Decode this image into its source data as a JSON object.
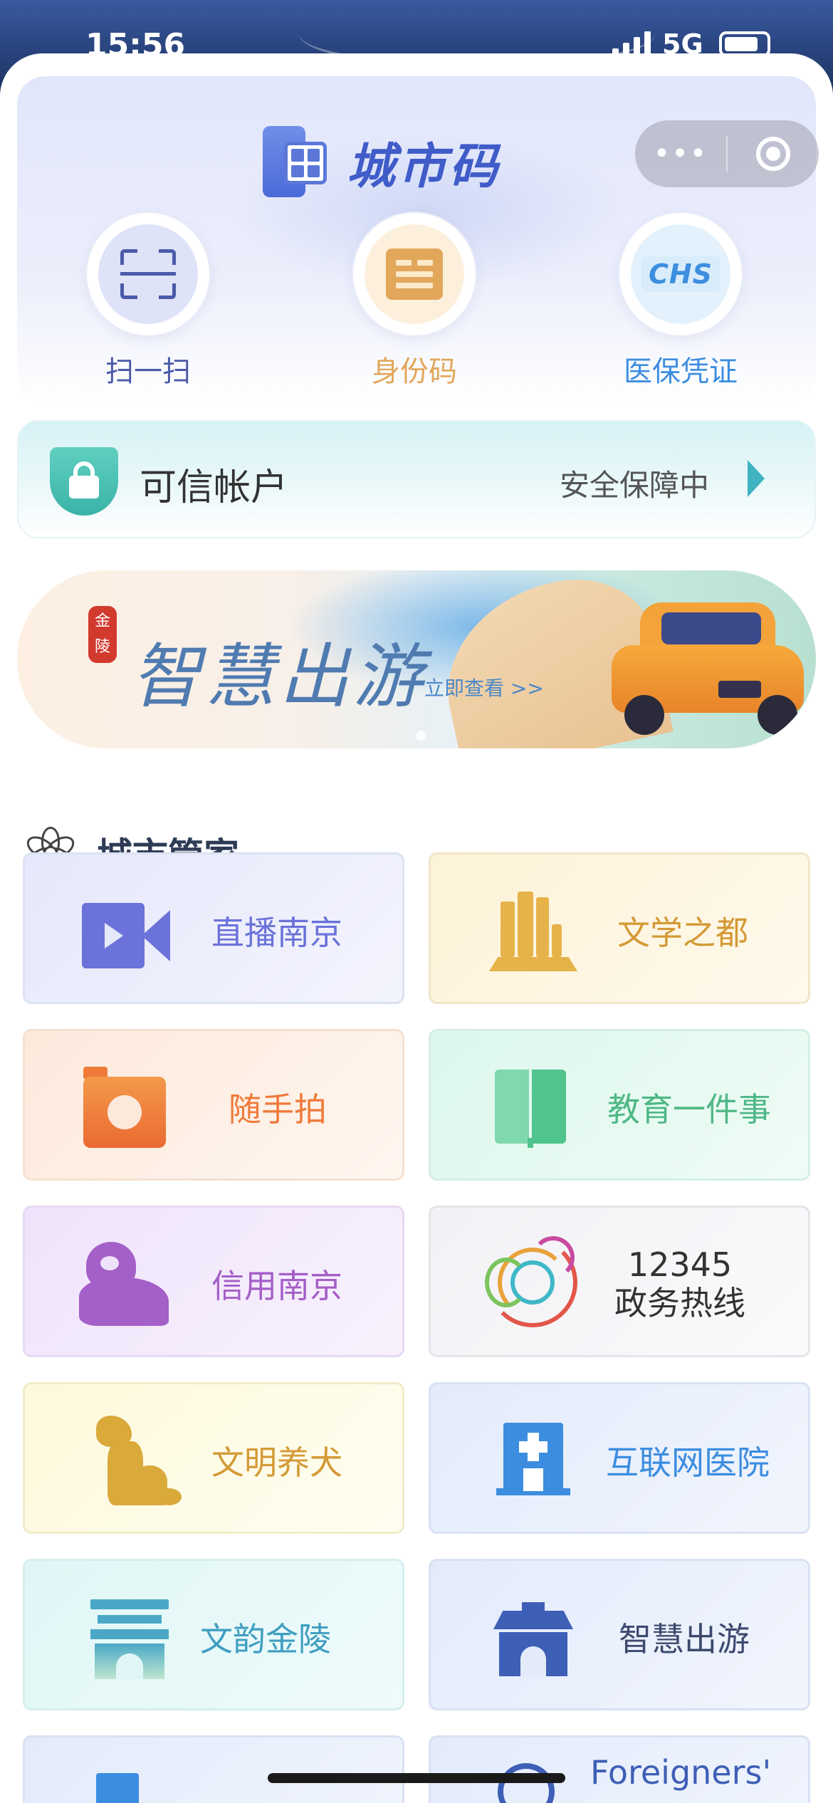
{
  "status_bar": {
    "time": "15:56",
    "network": "5G"
  },
  "header": {
    "app_title": "城市码",
    "capsule": {
      "more_icon": "more-dots-icon",
      "close_icon": "target-close-icon"
    }
  },
  "quick_actions": [
    {
      "label": "扫一扫",
      "icon": "scan-icon",
      "color": "#4b5aa8"
    },
    {
      "label": "身份码",
      "icon": "id-card-icon",
      "color": "#e2a75b"
    },
    {
      "label": "医保凭证",
      "icon": "chs-icon",
      "icon_text": "CHS",
      "color": "#3d8ee0"
    }
  ],
  "trust_account": {
    "title": "可信帐户",
    "status": "安全保障中",
    "icon": "shield-lock-icon"
  },
  "banner": {
    "seal": "金陵",
    "title": "智慧出游",
    "cta": "立即查看 >>"
  },
  "services": {
    "section_title": "城市管家",
    "tiles": [
      {
        "label": "直播南京",
        "icon": "video-camera-icon",
        "color": "#6b72d9"
      },
      {
        "label": "文学之都",
        "icon": "books-icon",
        "color": "#e6b34a"
      },
      {
        "label": "随手拍",
        "icon": "camera-icon",
        "color": "#ef7a3a"
      },
      {
        "label": "教育一件事",
        "icon": "book-icon",
        "color": "#4fc48c"
      },
      {
        "label": "信用南京",
        "icon": "lion-icon",
        "color": "#a55fc8"
      },
      {
        "label_line1": "12345",
        "label_line2": "政务热线",
        "icon": "hotline-icon",
        "color": "#333333"
      },
      {
        "label": "文明养犬",
        "icon": "dog-icon",
        "color": "#d9a93a"
      },
      {
        "label": "互联网医院",
        "icon": "hospital-icon",
        "color": "#3c8de0"
      },
      {
        "label": "文韵金陵",
        "icon": "gate-icon",
        "color": "#4aa8c6"
      },
      {
        "label": "智慧出游",
        "icon": "city-gate-icon",
        "color": "#3e5fb6"
      },
      {
        "label": "",
        "icon": "square-icon",
        "color": "#3c8de0"
      },
      {
        "label": "Foreigners'",
        "icon": "globe-icon",
        "color": "#3e5fb6"
      }
    ]
  }
}
